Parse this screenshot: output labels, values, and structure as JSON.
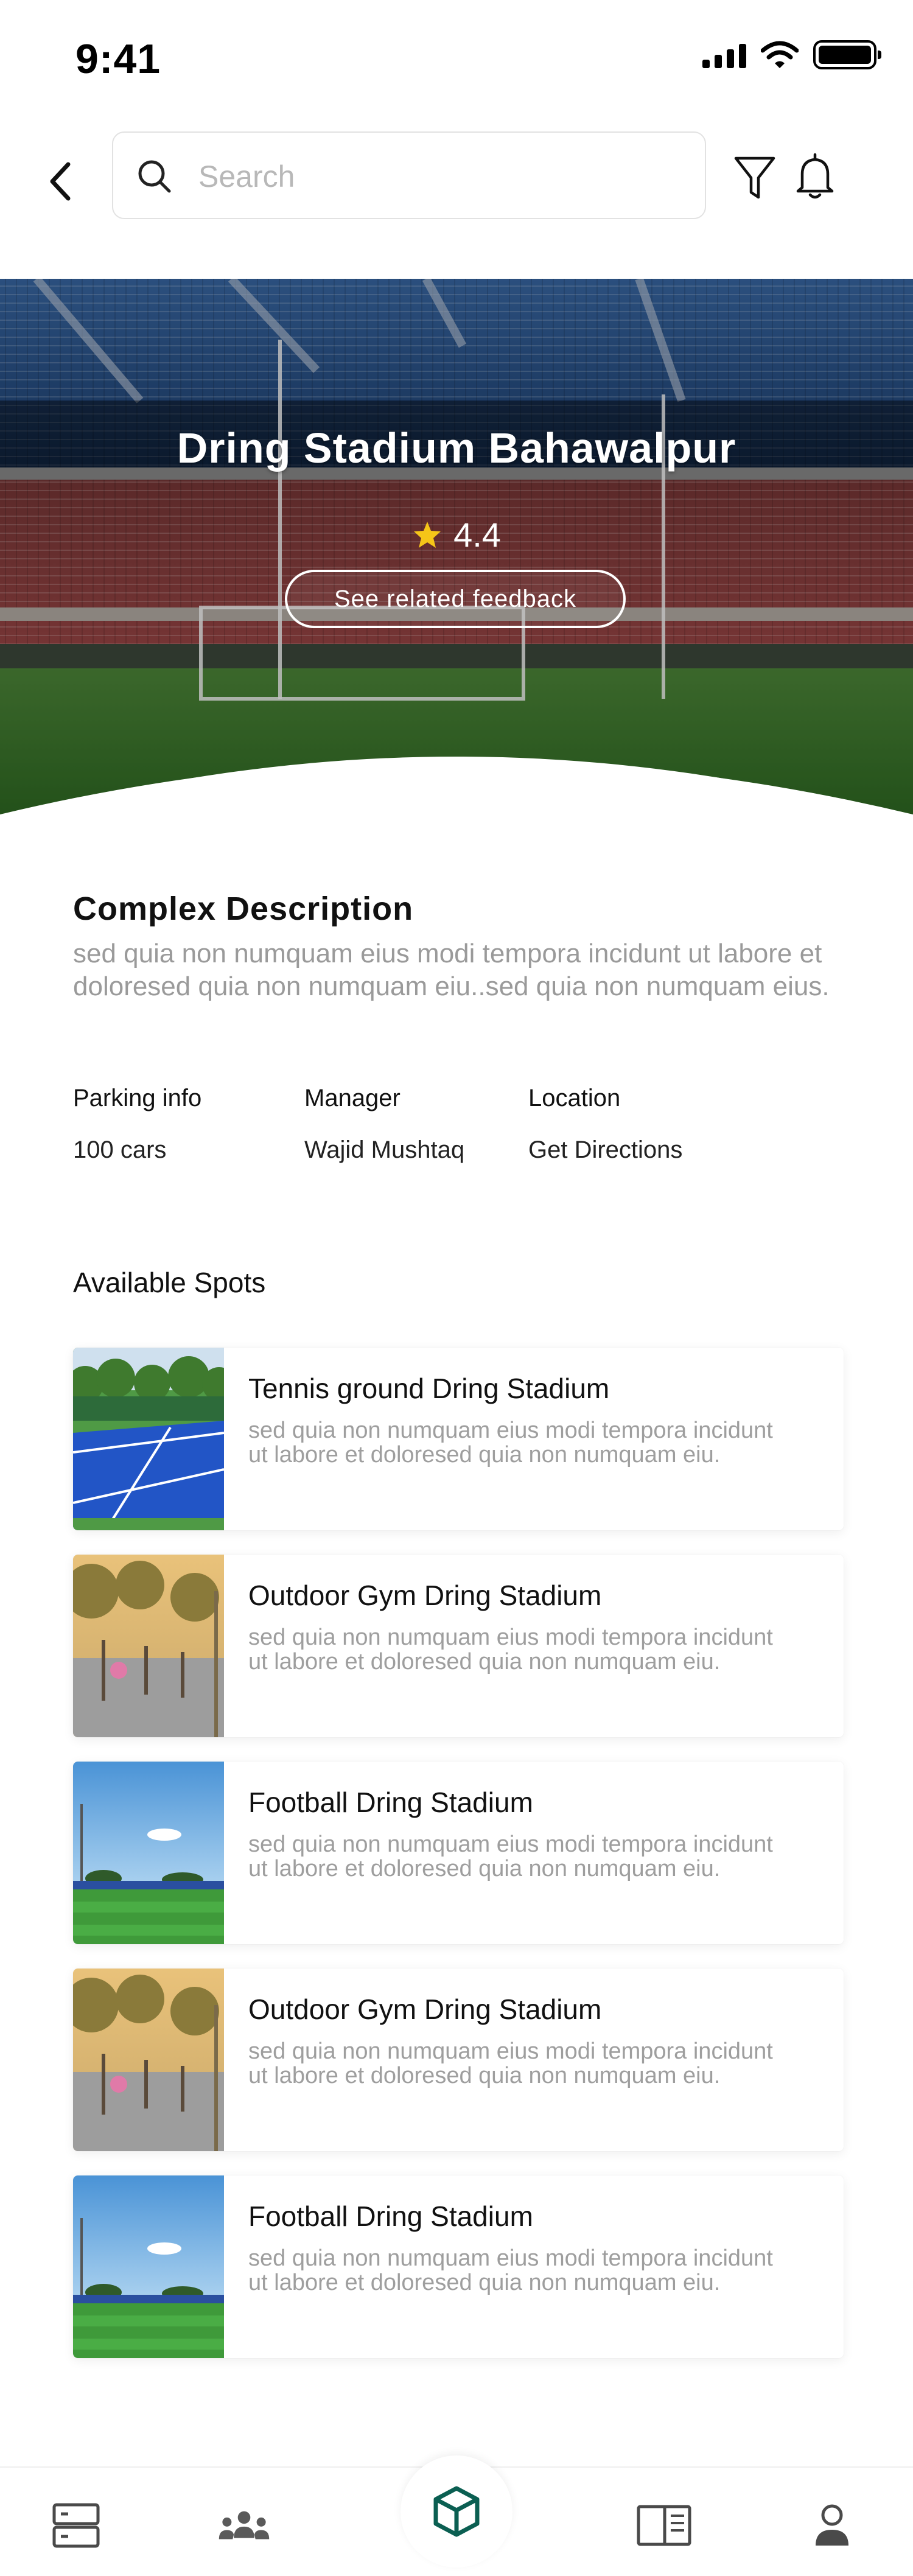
{
  "status_bar": {
    "time": "9:41"
  },
  "search": {
    "placeholder": "Search",
    "value": ""
  },
  "hero": {
    "title": "Dring Stadium Bahawalpur",
    "rating": "4.4",
    "feedback_button": "See related feedback"
  },
  "description": {
    "title": "Complex Description",
    "body": "sed quia non numquam eius modi tempora incidunt ut labore et doloresed quia non numquam eiu..sed quia non numquam eius."
  },
  "info": [
    {
      "label": "Parking info",
      "value": "100 cars"
    },
    {
      "label": "Manager",
      "value": "Wajid Mushtaq"
    },
    {
      "label": "Location",
      "value": "Get Directions"
    }
  ],
  "spots_title": "Available Spots",
  "spots": [
    {
      "title": "Tennis ground Dring Stadium",
      "desc": "sed quia non numquam eius modi tempora incidunt ut labore et doloresed quia non numquam eiu.",
      "thumb": "tennis"
    },
    {
      "title": "Outdoor Gym Dring Stadium",
      "desc": "sed quia non numquam eius modi tempora incidunt ut labore et doloresed quia non numquam eiu.",
      "thumb": "gym"
    },
    {
      "title": "Football Dring Stadium",
      "desc": "sed quia non numquam eius modi tempora incidunt ut labore et doloresed quia non numquam eiu.",
      "thumb": "football"
    },
    {
      "title": "Outdoor Gym Dring Stadium",
      "desc": "sed quia non numquam eius modi tempora incidunt ut labore et doloresed quia non numquam eiu.",
      "thumb": "gym"
    },
    {
      "title": "Football Dring Stadium",
      "desc": "sed quia non numquam eius modi tempora incidunt ut labore et doloresed quia non numquam eiu.",
      "thumb": "football"
    }
  ],
  "bottom_nav": [
    {
      "icon": "list-icon"
    },
    {
      "icon": "group-icon"
    },
    {
      "icon": "cube-icon",
      "active": true
    },
    {
      "icon": "book-icon"
    },
    {
      "icon": "profile-icon"
    }
  ],
  "colors": {
    "accent": "#0b5f52",
    "star": "#f5c518",
    "muted_text": "#9a9a9a"
  }
}
